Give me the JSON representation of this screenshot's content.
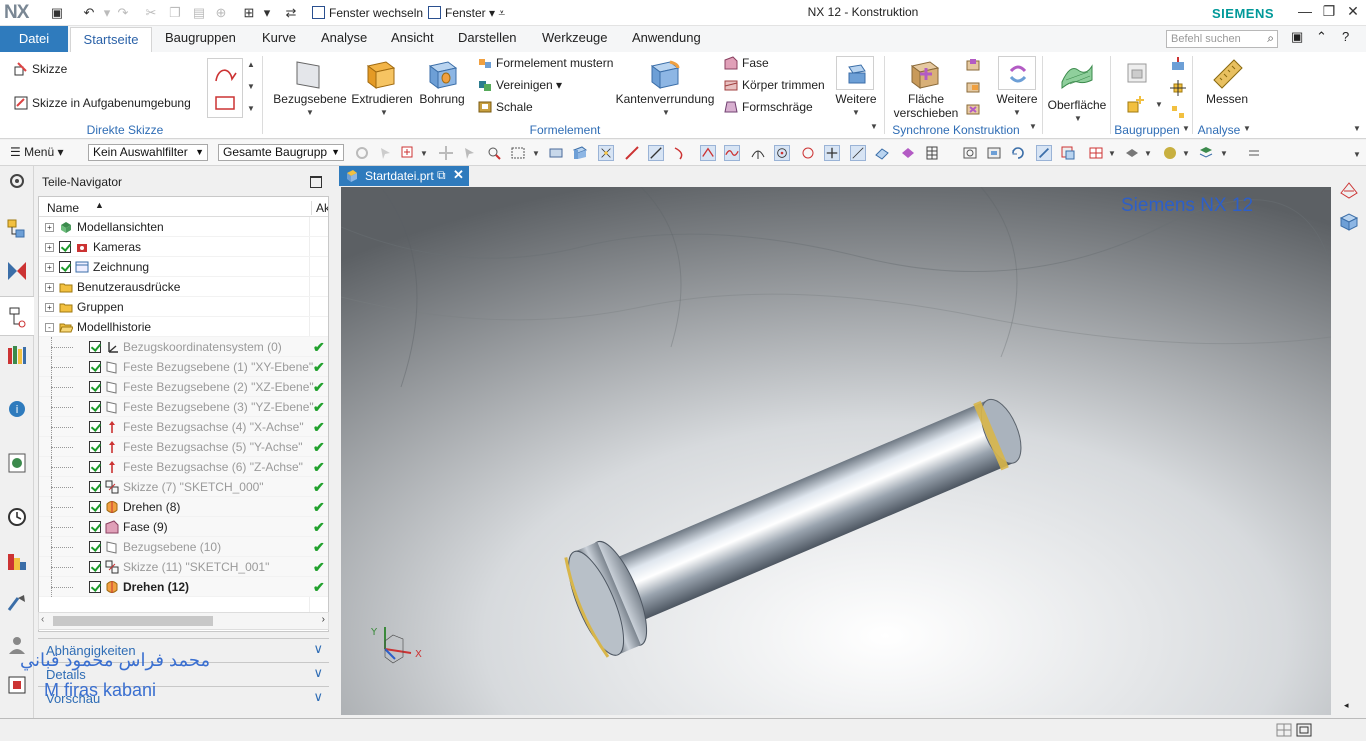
{
  "title_bar": {
    "logo": "NX",
    "window_switch": "Fenster wechseln",
    "window_menu": "Fenster",
    "window_title": "NX 12 - Konstruktion",
    "brand": "SIEMENS"
  },
  "menu_tabs": {
    "file": "Datei",
    "items": [
      "Startseite",
      "Baugruppen",
      "Kurve",
      "Analyse",
      "Ansicht",
      "Darstellen",
      "Werkzeuge",
      "Anwendung"
    ],
    "search_placeholder": "Befehl suchen"
  },
  "ribbon": {
    "sketch": "Skizze",
    "sketch_task": "Skizze in Aufgabenumgebung",
    "group_direct_sketch": "Direkte Skizze",
    "datum_plane": "Bezugsebene",
    "extrude": "Extrudieren",
    "hole": "Bohrung",
    "pattern_feature": "Formelement mustern",
    "unite": "Vereinigen",
    "shell": "Schale",
    "edge_blend": "Kantenverrundung",
    "chamfer": "Fase",
    "trim_body": "Körper trimmen",
    "draft": "Formschräge",
    "more1": "Weitere",
    "group_feature": "Formelement",
    "move_face_l1": "Fläche",
    "move_face_l2": "verschieben",
    "more2": "Weitere",
    "group_sync": "Synchrone Konstruktion",
    "surface": "Oberfläche",
    "group_assemblies": "Baugruppen",
    "measure": "Messen",
    "group_analysis": "Analyse"
  },
  "command_bar": {
    "menu": "Menü",
    "selection_filter": "Kein Auswahlfilter",
    "scope": "Gesamte Baugrupp"
  },
  "navigator": {
    "title": "Teile-Navigator",
    "col_name": "Name",
    "col_active": "Ak",
    "nodes": [
      {
        "label": "Modellansichten",
        "level": 0,
        "expand": "+",
        "check": false,
        "grey": false,
        "bold": false,
        "ok": false,
        "icon": "model-views-icon"
      },
      {
        "label": "Kameras",
        "level": 0,
        "expand": "+",
        "check": true,
        "grey": false,
        "bold": false,
        "ok": false,
        "icon": "camera-icon"
      },
      {
        "label": "Zeichnung",
        "level": 0,
        "expand": "+",
        "check": true,
        "grey": false,
        "bold": false,
        "ok": false,
        "icon": "drawing-icon"
      },
      {
        "label": "Benutzerausdrücke",
        "level": 0,
        "expand": "+",
        "check": false,
        "grey": false,
        "bold": false,
        "ok": false,
        "icon": "folder-icon"
      },
      {
        "label": "Gruppen",
        "level": 0,
        "expand": "+",
        "check": false,
        "grey": false,
        "bold": false,
        "ok": false,
        "icon": "folder-icon"
      },
      {
        "label": "Modellhistorie",
        "level": 0,
        "expand": "-",
        "check": false,
        "grey": false,
        "bold": false,
        "ok": false,
        "icon": "open-folder-icon"
      },
      {
        "label": "Bezugskoordinatensystem (0)",
        "level": 1,
        "check": true,
        "grey": true,
        "bold": false,
        "ok": true,
        "icon": "csys-icon"
      },
      {
        "label": "Feste Bezugsebene (1) \"XY-Ebene\"",
        "level": 1,
        "check": true,
        "grey": true,
        "bold": false,
        "ok": true,
        "icon": "plane-icon"
      },
      {
        "label": "Feste Bezugsebene (2) \"XZ-Ebene\"",
        "level": 1,
        "check": true,
        "grey": true,
        "bold": false,
        "ok": true,
        "icon": "plane-icon"
      },
      {
        "label": "Feste Bezugsebene (3) \"YZ-Ebene\"",
        "level": 1,
        "check": true,
        "grey": true,
        "bold": false,
        "ok": true,
        "icon": "plane-icon"
      },
      {
        "label": "Feste Bezugsachse (4) \"X-Achse\"",
        "level": 1,
        "check": true,
        "grey": true,
        "bold": false,
        "ok": true,
        "icon": "axis-icon"
      },
      {
        "label": "Feste Bezugsachse (5) \"Y-Achse\"",
        "level": 1,
        "check": true,
        "grey": true,
        "bold": false,
        "ok": true,
        "icon": "axis-icon"
      },
      {
        "label": "Feste Bezugsachse (6) \"Z-Achse\"",
        "level": 1,
        "check": true,
        "grey": true,
        "bold": false,
        "ok": true,
        "icon": "axis-icon"
      },
      {
        "label": "Skizze (7) \"SKETCH_000\"",
        "level": 1,
        "check": true,
        "grey": true,
        "bold": false,
        "ok": true,
        "icon": "sketch-icon"
      },
      {
        "label": "Drehen (8)",
        "level": 1,
        "check": true,
        "grey": false,
        "bold": false,
        "ok": true,
        "icon": "revolve-icon"
      },
      {
        "label": "Fase (9)",
        "level": 1,
        "check": true,
        "grey": false,
        "bold": false,
        "ok": true,
        "icon": "chamfer-icon"
      },
      {
        "label": "Bezugsebene (10)",
        "level": 1,
        "check": true,
        "grey": true,
        "bold": false,
        "ok": true,
        "icon": "plane-icon"
      },
      {
        "label": "Skizze (11) \"SKETCH_001\"",
        "level": 1,
        "check": true,
        "grey": true,
        "bold": false,
        "ok": true,
        "icon": "sketch-icon"
      },
      {
        "label": "Drehen (12)",
        "level": 1,
        "check": true,
        "grey": false,
        "bold": true,
        "ok": true,
        "icon": "revolve-icon"
      }
    ],
    "panels": [
      "Abhängigkeiten",
      "Details",
      "Vorschau"
    ],
    "watermark_ar": "محمد فراس محمود قباني",
    "watermark_en": "M firas kabani"
  },
  "document": {
    "tab": "Startdatei.prt",
    "viewport_label": "Siemens NX 12",
    "triad_x": "X",
    "triad_y": "Y"
  },
  "colors": {
    "accent": "#2f7bbd",
    "brand": "#009999",
    "ok": "#22a12e"
  }
}
